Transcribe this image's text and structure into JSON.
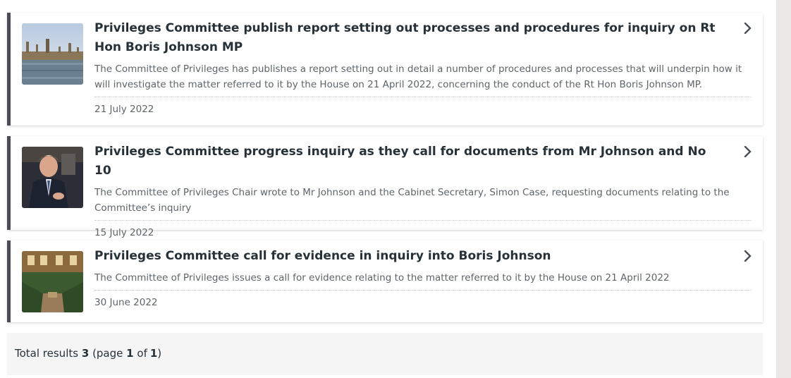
{
  "results": [
    {
      "title": "Privileges Committee publish report setting out processes and procedures for inquiry on Rt Hon Boris Johnson MP",
      "description": "The Committee of Privileges has publishes a report setting out in detail a number of procedures and processes that will underpin how it will investigate the matter referred to it by the House on 21 April 2022, concerning the conduct of the Rt Hon Boris Johnson MP.",
      "date": "21 July 2022",
      "image": "westminster-palace-photo"
    },
    {
      "title": "Privileges Committee progress inquiry as they call for documents from Mr Johnson and No 10",
      "description": "The Committee of Privileges Chair wrote to Mr Johnson and the Cabinet Secretary, Simon Case, requesting documents relating to the Committee’s inquiry",
      "date": "15 July 2022",
      "image": "boris-johnson-photo"
    },
    {
      "title": "Privileges Committee call for evidence in inquiry into Boris Johnson",
      "description": "The Committee of Privileges issues a call for evidence relating to the matter referred to it by the House on 21 April 2022",
      "date": "30 June 2022",
      "image": "house-of-commons-chamber-photo"
    }
  ],
  "pagination": {
    "prefix": "Total results",
    "total": "3",
    "page_open": "(page",
    "page": "1",
    "of": "of",
    "pages": "1",
    "close": ")"
  },
  "icons": {
    "chevron": "chevron-right-icon"
  }
}
